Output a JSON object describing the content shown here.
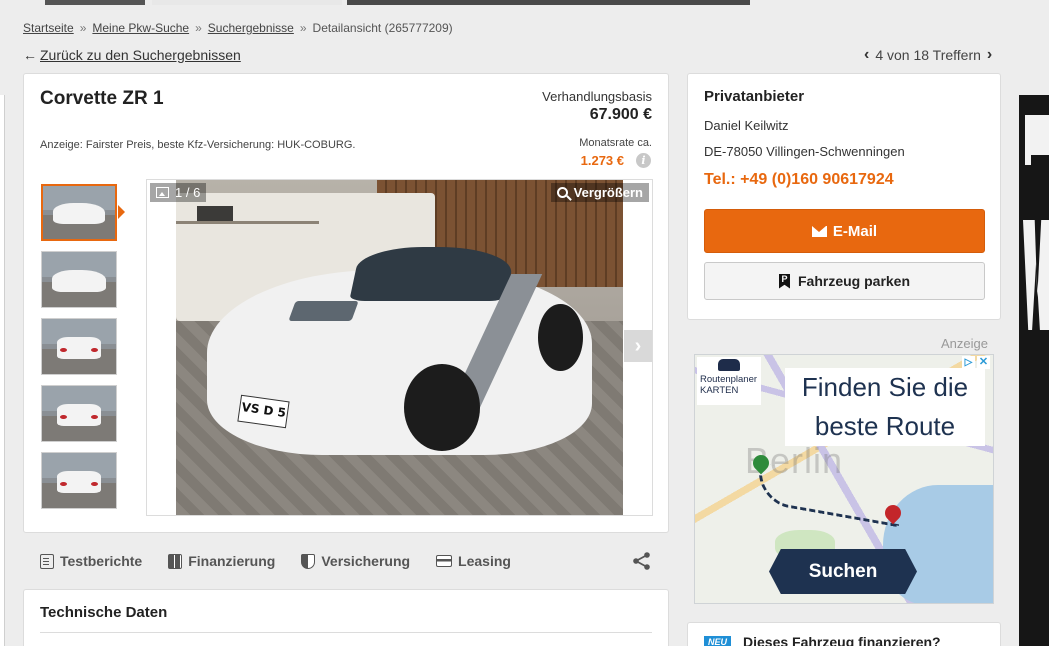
{
  "breadcrumb": {
    "items": [
      "Startseite",
      "Meine Pkw-Suche",
      "Suchergebnisse"
    ],
    "current": "Detailansicht (265777209)",
    "separator": "»"
  },
  "back_link": "Zurück zu den Suchergebnissen",
  "pager": {
    "text": "4 von 18 Treffern"
  },
  "listing": {
    "title": "Corvette ZR 1",
    "price_label": "Verhandlungsbasis",
    "price": "67.900 €",
    "insurance_ad": "Anzeige:  Fairster Preis, beste Kfz-Versicherung: HUK-COBURG.",
    "rate_label": "Monatsrate ca.",
    "rate": "1.273 €",
    "info_glyph": "i"
  },
  "gallery": {
    "counter": "1 / 6",
    "zoom_label": "Vergrößern",
    "next_glyph": "›",
    "thumb_count": 5,
    "selected_index": 0,
    "plate": "VS D 5"
  },
  "actions": {
    "items": [
      "Testberichte",
      "Finanzierung",
      "Versicherung",
      "Leasing"
    ]
  },
  "tech": {
    "title": "Technische Daten"
  },
  "seller": {
    "type": "Privatanbieter",
    "name": "Daniel Keilwitz",
    "location": "DE-78050 Villingen-Schwenningen",
    "phone": "Tel.: +49 (0)160 90617924",
    "email_button": "E-Mail",
    "park_button": "Fahrzeug parken",
    "park_glyph": "P"
  },
  "ad": {
    "label": "Anzeige",
    "logo_line1": "Routenplaner",
    "logo_line2": "KARTEN",
    "headline_line1": "Finden Sie die",
    "headline_line2": "beste Route",
    "city": "Berlin",
    "button": "Suchen",
    "info_glyph": "▷",
    "close_glyph": "✕"
  },
  "finance": {
    "badge": "NEU",
    "title": "Dieses Fahrzeug finanzieren?"
  },
  "colors": {
    "accent": "#e8680f",
    "ad_navy": "#1e3250",
    "background": "#ededed"
  }
}
